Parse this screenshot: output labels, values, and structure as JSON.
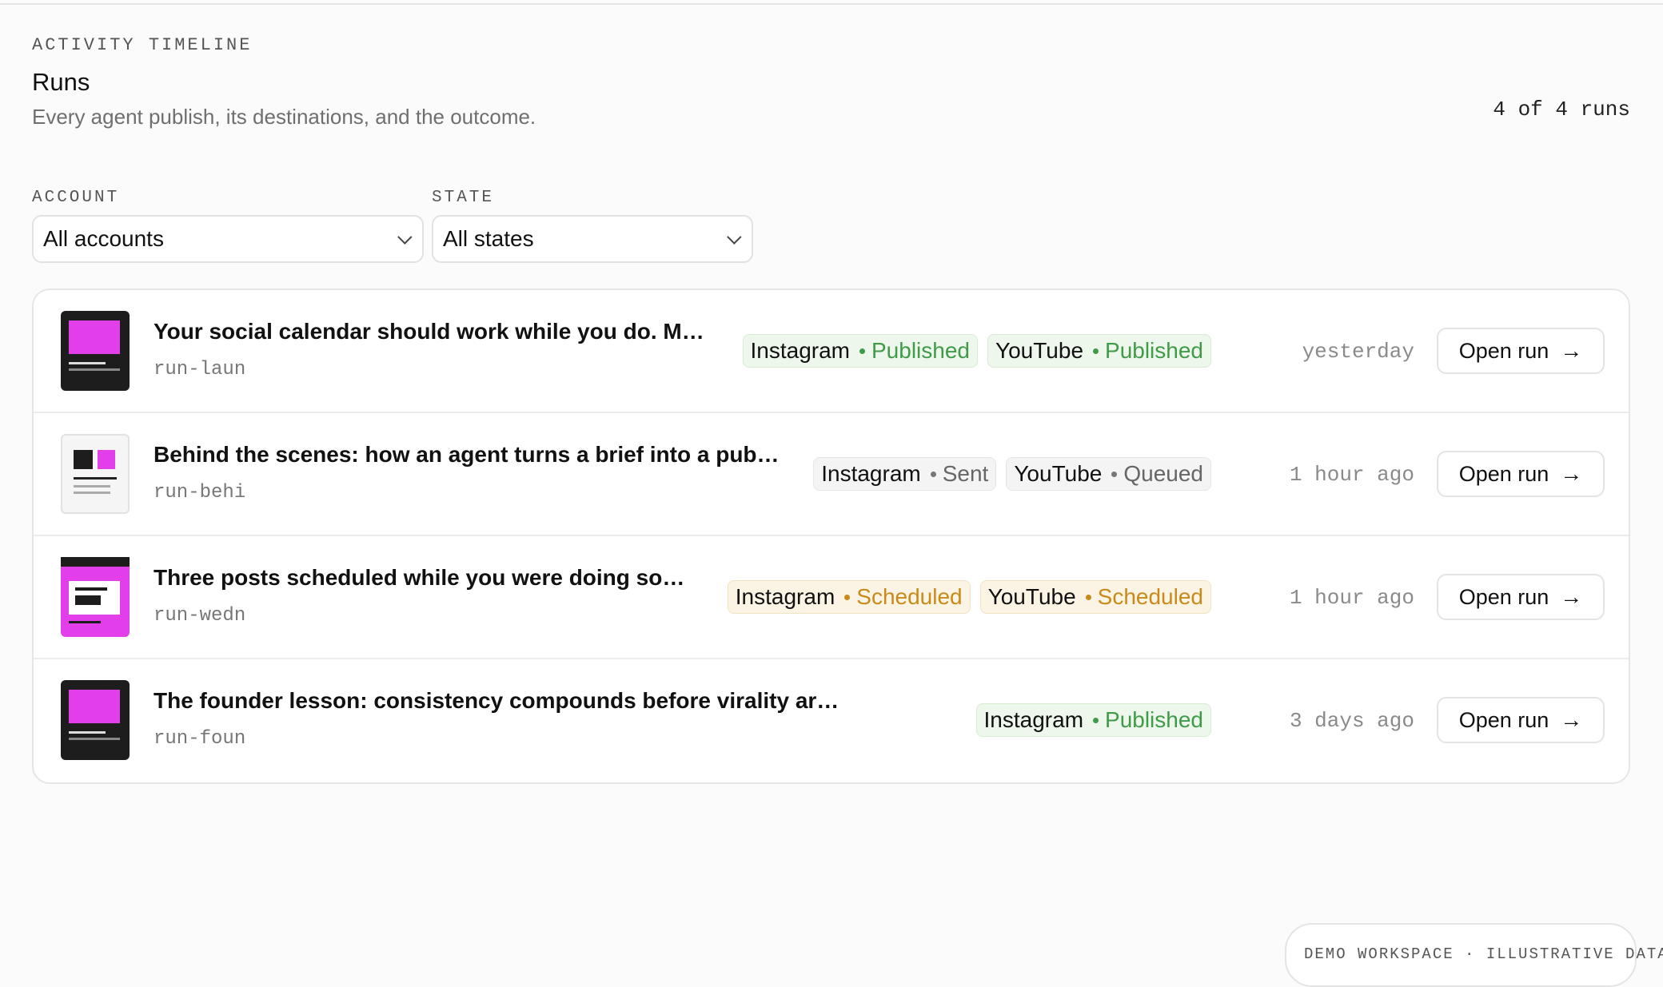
{
  "header": {
    "eyebrow": "ACTIVITY TIMELINE",
    "title": "Runs",
    "subtitle": "Every agent publish, its destinations, and the outcome.",
    "count": "4 of 4 runs"
  },
  "filters": {
    "account": {
      "label": "ACCOUNT",
      "value": "All accounts"
    },
    "state": {
      "label": "STATE",
      "value": "All states"
    }
  },
  "runs": [
    {
      "title": "Your social calendar should work while you do. M…",
      "id": "run-laun",
      "destinations": [
        {
          "platform": "Instagram",
          "status": "Published"
        },
        {
          "platform": "YouTube",
          "status": "Published"
        }
      ],
      "when": "yesterday",
      "action": "Open run"
    },
    {
      "title": "Behind the scenes: how an agent turns a brief into a pub…",
      "id": "run-behi",
      "destinations": [
        {
          "platform": "Instagram",
          "status": "Sent"
        },
        {
          "platform": "YouTube",
          "status": "Queued"
        }
      ],
      "when": "1 hour ago",
      "action": "Open run"
    },
    {
      "title": "Three posts scheduled while you were doing so…",
      "id": "run-wedn",
      "destinations": [
        {
          "platform": "Instagram",
          "status": "Scheduled"
        },
        {
          "platform": "YouTube",
          "status": "Scheduled"
        }
      ],
      "when": "1 hour ago",
      "action": "Open run"
    },
    {
      "title": "The founder lesson: consistency compounds before virality ar…",
      "id": "run-foun",
      "destinations": [
        {
          "platform": "Instagram",
          "status": "Published"
        }
      ],
      "when": "3 days ago",
      "action": "Open run"
    }
  ],
  "footer_badge": "DEMO WORKSPACE · ILLUSTRATIVE DATA",
  "colors": {
    "published": "#3f9b48",
    "scheduled": "#c98a1a",
    "neutral": "#666666",
    "thumb_accent": "#e23fea"
  }
}
